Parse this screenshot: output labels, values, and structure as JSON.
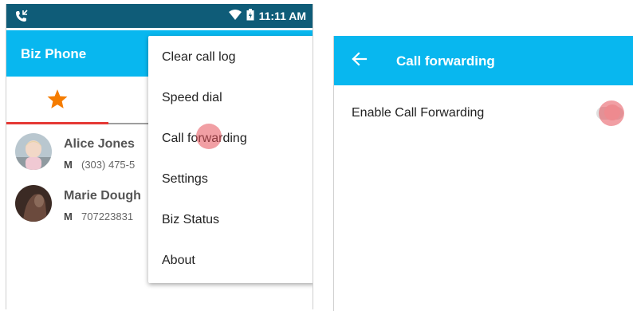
{
  "left_screen": {
    "status_bar": {
      "time": "11:11 AM"
    },
    "app_title": "Biz Phone",
    "contacts": [
      {
        "name": "Alice Jones",
        "type": "M",
        "phone": "(303) 475-5"
      },
      {
        "name": "Marie Dough",
        "type": "M",
        "phone": "707223831"
      }
    ],
    "menu": {
      "items": [
        "Clear call log",
        "Speed dial",
        "Call forwarding",
        "Settings",
        "Biz Status",
        "About"
      ]
    }
  },
  "right_screen": {
    "title": "Call forwarding",
    "setting_label": "Enable Call Forwarding",
    "toggle_state": "off"
  },
  "colors": {
    "status_bar": "#0f5c78",
    "app_bar": "#08b7ef",
    "accent": "#e53935",
    "star": "#f57c00"
  }
}
